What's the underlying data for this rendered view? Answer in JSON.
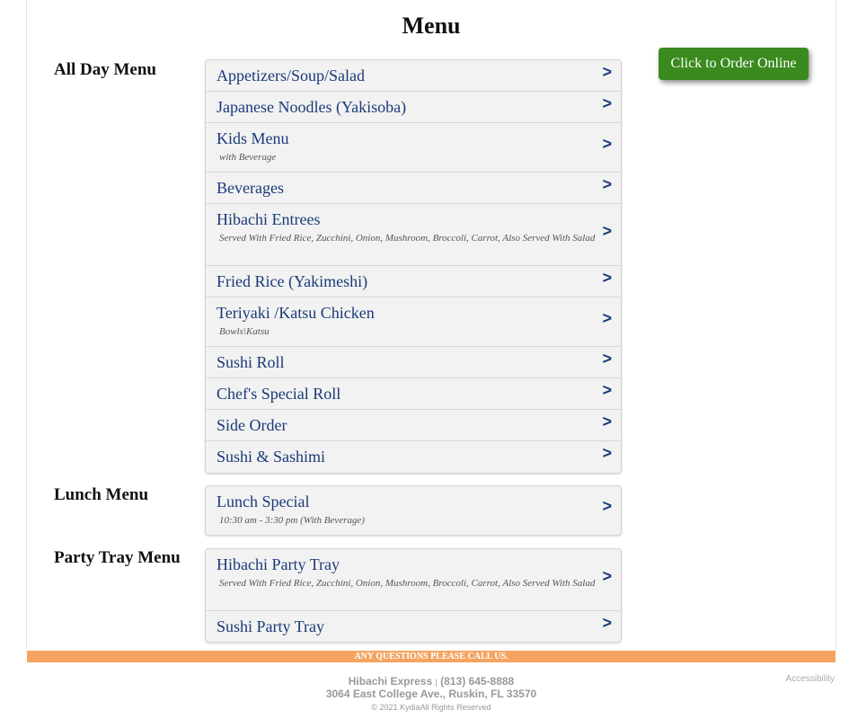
{
  "page": {
    "title": "Menu"
  },
  "order_button": {
    "label": "Click to Order Online"
  },
  "sections": [
    {
      "label": "All Day Menu",
      "items": [
        {
          "title": "Appetizers/Soup/Salad",
          "desc": ""
        },
        {
          "title": "Japanese Noodles (Yakisoba)",
          "desc": ""
        },
        {
          "title": "Kids Menu",
          "desc": "with Beverage"
        },
        {
          "title": "Beverages",
          "desc": ""
        },
        {
          "title": "Hibachi Entrees",
          "desc": "Served With Fried Rice, Zucchini, Onion, Mushroom, Broccoli, Carrot, Also Served With Salad"
        },
        {
          "title": "Fried Rice (Yakimeshi)",
          "desc": ""
        },
        {
          "title": "Teriyaki /Katsu Chicken",
          "desc": "Bowls\\Katsu"
        },
        {
          "title": "Sushi Roll",
          "desc": ""
        },
        {
          "title": "Chef's Special Roll",
          "desc": ""
        },
        {
          "title": "Side Order",
          "desc": ""
        },
        {
          "title": "Sushi & Sashimi",
          "desc": ""
        }
      ]
    },
    {
      "label": "Lunch Menu",
      "items": [
        {
          "title": "Lunch Special",
          "desc": "10:30 am - 3:30 pm (With Beverage)"
        }
      ]
    },
    {
      "label": "Party Tray Menu",
      "items": [
        {
          "title": "Hibachi Party Tray",
          "desc": "Served With Fried Rice, Zucchini, Onion, Mushroom, Broccoli, Carrot, Also Served With Salad"
        },
        {
          "title": "Sushi Party Tray",
          "desc": ""
        }
      ]
    }
  ],
  "chevron_glyph": ">",
  "footer": {
    "banner": "ANY QUESTIONS PLEASE CALL US.",
    "business_name": "Hibachi Express",
    "separator": "|",
    "phone": "(813) 645-8888",
    "address": "3064 East College Ave., Ruskin, FL 33570",
    "copyright": "© 2021",
    "provider": "Kydia",
    "rights": "All Rights Reserved",
    "accessibility": "Accessibility"
  },
  "colors": {
    "order_button": "#3a8a1e",
    "item_title": "#1a3a78",
    "footer_banner": "#f4a460"
  }
}
